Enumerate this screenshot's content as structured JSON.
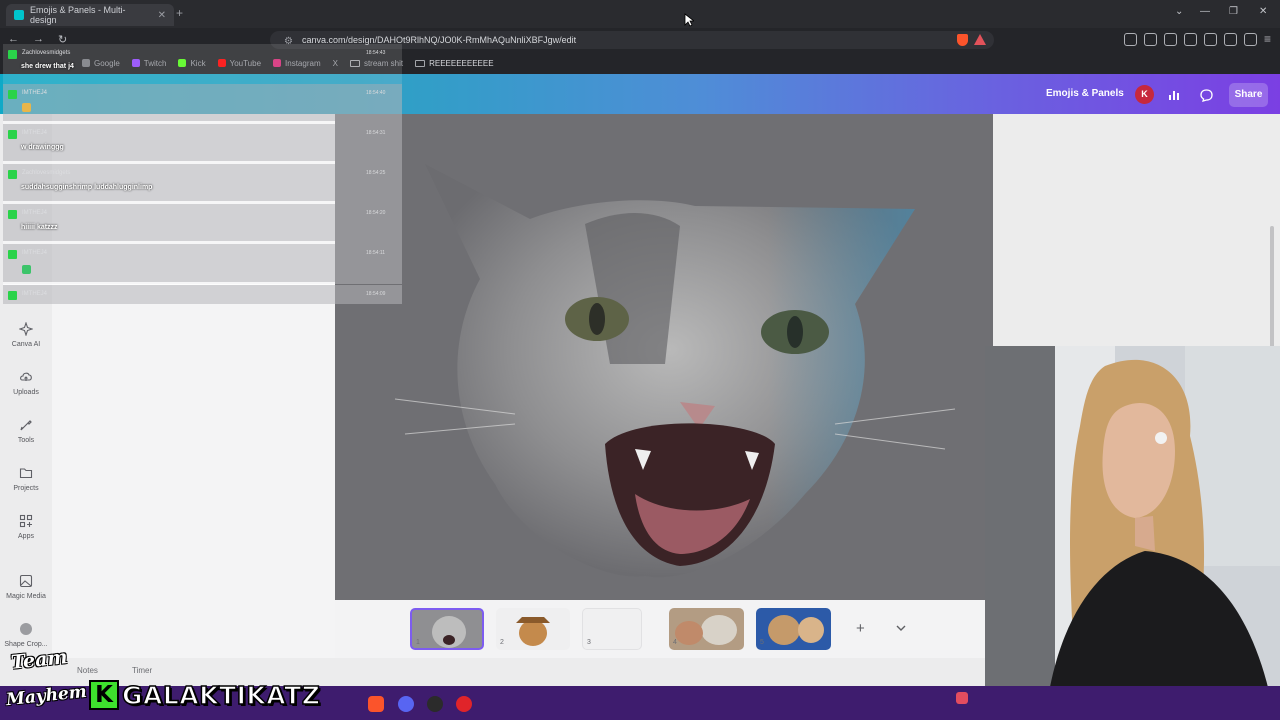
{
  "browser": {
    "tab_title": "Emojis & Panels - Multi-design",
    "url": "canva.com/design/DAHOt9RlhNQ/JO0K-RmMhAQuNnliXBFJgw/edit",
    "bookmarks": [
      "Google",
      "Twitch",
      "Kick",
      "YouTube",
      "Instagram",
      "X",
      "stream shit",
      "REEEEEEEEEEE"
    ],
    "bookmark_colors": [
      "#7a7c82",
      "#9146ff",
      "#53fc18",
      "#ff0000",
      "#d62976",
      "#9c9ea4"
    ]
  },
  "canva": {
    "header": {
      "design_name": "Emojis & Panels",
      "avatar_letter": "K",
      "share_label": "Share"
    },
    "rail": [
      {
        "icon": "canva-ai-icon",
        "label": "Canva AI"
      },
      {
        "icon": "uploads-icon",
        "label": "Uploads"
      },
      {
        "icon": "tools-icon",
        "label": "Tools"
      },
      {
        "icon": "projects-icon",
        "label": "Projects"
      },
      {
        "icon": "apps-icon",
        "label": "Apps"
      },
      {
        "icon": "magic-media-icon",
        "label": "Magic Media"
      },
      {
        "icon": "shape-crop-icon",
        "label": "Shape Crop..."
      }
    ],
    "pages": [
      "1",
      "2",
      "3",
      "4",
      "5"
    ],
    "bottom": {
      "notes": "Notes",
      "timer": "Timer"
    }
  },
  "chat": [
    {
      "user": "Zachlovesmidgets",
      "time": "18:54:43",
      "text": "she drew that j4"
    },
    {
      "user": "IMTHEJ4",
      "time": "18:54:40",
      "text": ""
    },
    {
      "user": "IMTHEJ4",
      "time": "18:54:31",
      "text": "w drawinggg"
    },
    {
      "user": "Zachlovesmidgets",
      "time": "18:54:25",
      "text": "suddahsugginshrimp luddahlugginlimp"
    },
    {
      "user": "IMTHEJ4",
      "time": "18:54:20",
      "text": "hiiiii katzzz"
    },
    {
      "user": "IMTHEJ4",
      "time": "18:54:11",
      "text": ""
    },
    {
      "user": "IMTHEJ4",
      "time": "18:54:09",
      "text": ""
    }
  ],
  "overlay": {
    "team_line1": "Team",
    "team_line2": "Mayhem",
    "k_logo": "K",
    "channel_name": "GALAKTIKATZ"
  },
  "colors": {
    "chat_logo": "#2ad34a",
    "kick_green": "#3ee12d",
    "canva_gradient_start": "#0fa9c7",
    "canva_gradient_end": "#7b3fe3",
    "taskbar": "#3e1c6e"
  }
}
